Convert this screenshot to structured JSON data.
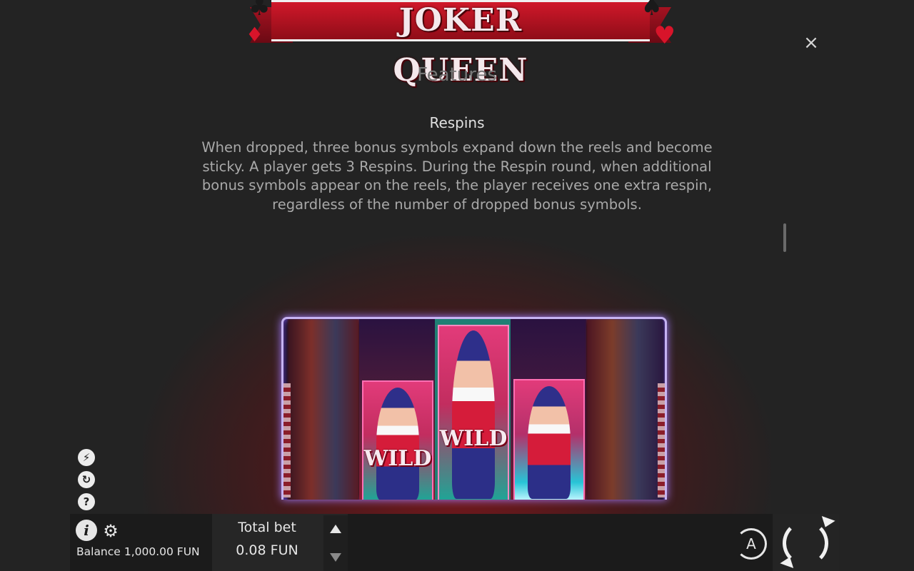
{
  "logo": {
    "text": "JOKER QUEEN"
  },
  "help": {
    "close_label": "×",
    "section_heading": "Features",
    "feature_title": "Respins",
    "feature_text": "When dropped, three bonus symbols expand down the reels and become sticky. A player gets 3 Respins. During the Respin round, when additional bonus symbols appear on the reels, the player receives one extra respin, regardless of the number of dropped bonus symbols."
  },
  "illustration": {
    "wild_label_1": "WILD",
    "wild_label_2": "WILD"
  },
  "side_icons": {
    "turbo": "⚡",
    "replay": "↻",
    "help": "?"
  },
  "toolbar": {
    "info_label": "i",
    "gear_glyph": "⚙",
    "balance_label": "Balance",
    "balance_value": "1,000.00 FUN",
    "total_bet_label": "Total bet",
    "total_bet_value": "0.08 FUN",
    "autoplay_label": "A"
  },
  "colors": {
    "background": "#232323",
    "accent_red": "#d0182a",
    "reel_frame": "#c6b3f2"
  }
}
